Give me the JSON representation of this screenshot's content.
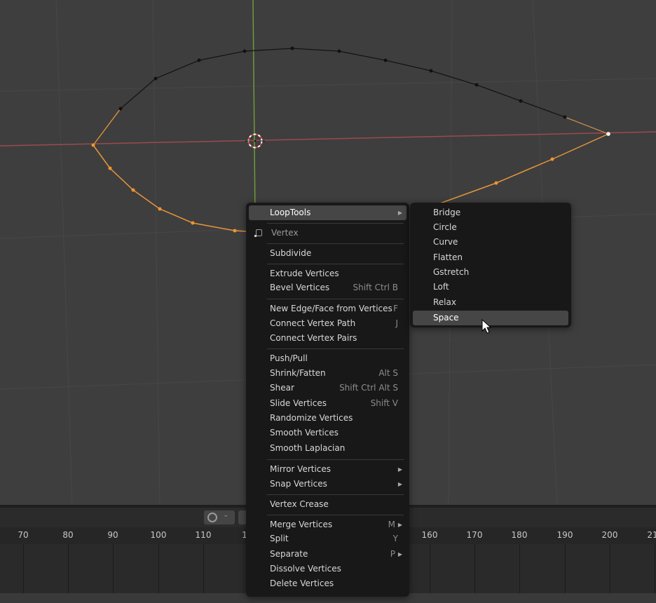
{
  "timeline": {
    "frames": [
      "70",
      "80",
      "90",
      "100",
      "110",
      "1",
      "160",
      "170",
      "180",
      "190",
      "200",
      "21"
    ]
  },
  "main_menu": {
    "loop_tools": "LoopTools",
    "vertex_title": "Vertex",
    "subdivide": "Subdivide",
    "extrude_vertices": "Extrude Vertices",
    "bevel_vertices": {
      "label": "Bevel Vertices",
      "shortcut": "Shift Ctrl B"
    },
    "new_edge_face": {
      "label": "New Edge/Face from Vertices",
      "shortcut": "F"
    },
    "connect_vertex_path": {
      "label": "Connect Vertex Path",
      "shortcut": "J"
    },
    "connect_vertex_pairs": "Connect Vertex Pairs",
    "push_pull": "Push/Pull",
    "shrink_fatten": {
      "label": "Shrink/Fatten",
      "shortcut": "Alt S"
    },
    "shear": {
      "label": "Shear",
      "shortcut": "Shift Ctrl Alt S"
    },
    "slide_vertices": {
      "label": "Slide Vertices",
      "shortcut": "Shift V"
    },
    "randomize_vertices": "Randomize Vertices",
    "smooth_vertices": "Smooth Vertices",
    "smooth_laplacian": "Smooth Laplacian",
    "mirror_vertices": "Mirror Vertices",
    "snap_vertices": "Snap Vertices",
    "vertex_crease": "Vertex Crease",
    "merge_vertices": {
      "label": "Merge Vertices",
      "shortcut": "M"
    },
    "split": {
      "label": "Split",
      "shortcut": "Y"
    },
    "separate": {
      "label": "Separate",
      "shortcut": "P"
    },
    "dissolve_vertices": "Dissolve Vertices",
    "delete_vertices": "Delete Vertices"
  },
  "loop_tools_menu": [
    "Bridge",
    "Circle",
    "Curve",
    "Flatten",
    "Gstretch",
    "Loft",
    "Relax",
    "Space"
  ],
  "colors": {
    "x_axis": "#9c4a4f",
    "y_axis": "#6f9a3a",
    "selected_edge": "#e7953a",
    "menu_bg": "#181818",
    "highlight": "#464646"
  }
}
